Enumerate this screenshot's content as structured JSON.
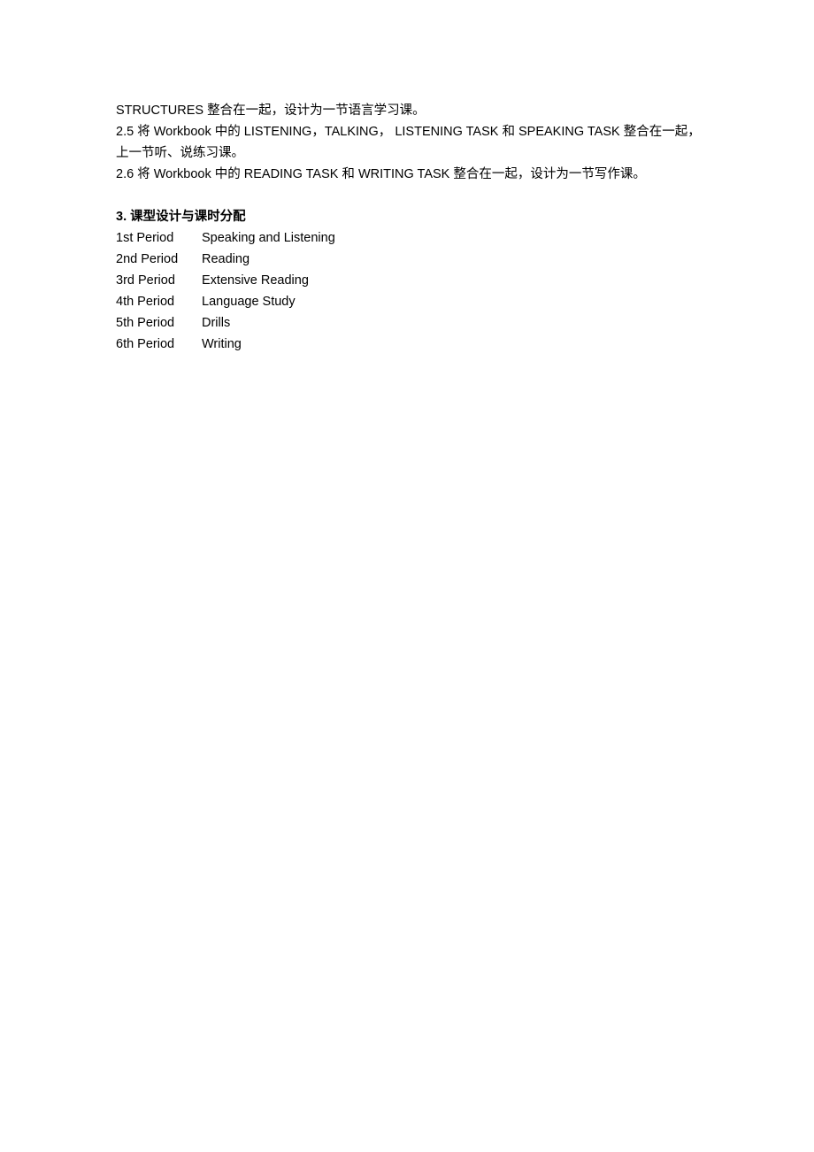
{
  "document": {
    "paragraphs": [
      "STRUCTURES  整合在一起，设计为一节语言学习课。",
      "2.5  将 Workbook  中的 LISTENING，TALKING，  LISTENING TASK  和 SPEAKING TASK  整合在一起，",
      "上一节听、说练习课。",
      "2.6  将 Workbook  中的 READING TASK  和 WRITING TASK  整合在一起，设计为一节写作课。"
    ],
    "section3": {
      "heading": "3.  课型设计与课时分配",
      "periods": [
        {
          "period": "1st Period",
          "type": "Speaking and Listening"
        },
        {
          "period": "2nd Period",
          "type": "Reading"
        },
        {
          "period": "3rd Period",
          "type": "Extensive Reading"
        },
        {
          "period": "4th Period",
          "type": "Language Study"
        },
        {
          "period": "5th Period",
          "type": "Drills"
        },
        {
          "period": "6th Period",
          "type": "Writing"
        }
      ]
    }
  }
}
